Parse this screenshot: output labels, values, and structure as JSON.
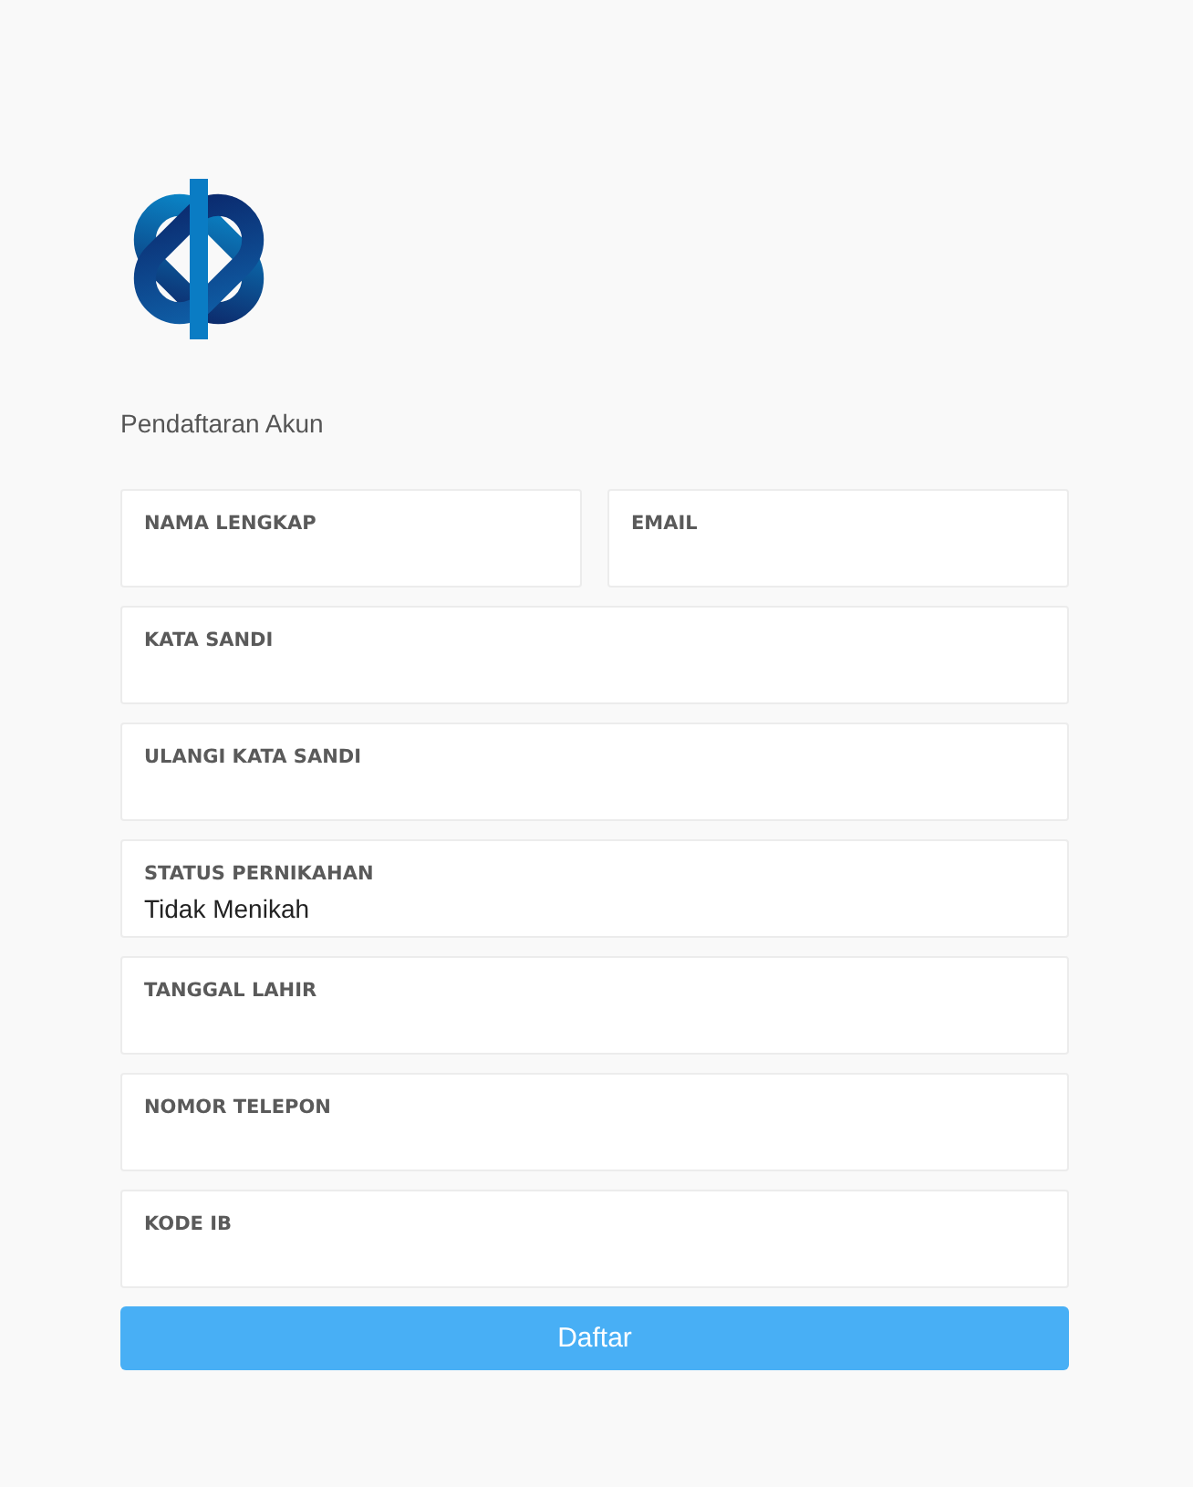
{
  "heading": "Pendaftaran Akun",
  "rows": [
    [
      {
        "label": "NAMA LENGKAP"
      },
      {
        "label": "EMAIL"
      }
    ],
    [
      {
        "label": "KATA SANDI"
      }
    ],
    [
      {
        "label": "ULANGI KATA SANDI"
      }
    ],
    [
      {
        "label": "STATUS PERNIKAHAN",
        "value": "Tidak Menikah"
      }
    ],
    [
      {
        "label": "TANGGAL LAHIR"
      }
    ],
    [
      {
        "label": "NOMOR TELEPON"
      }
    ],
    [
      {
        "label": "KODE IB"
      }
    ]
  ],
  "submit_button": "Daftar"
}
